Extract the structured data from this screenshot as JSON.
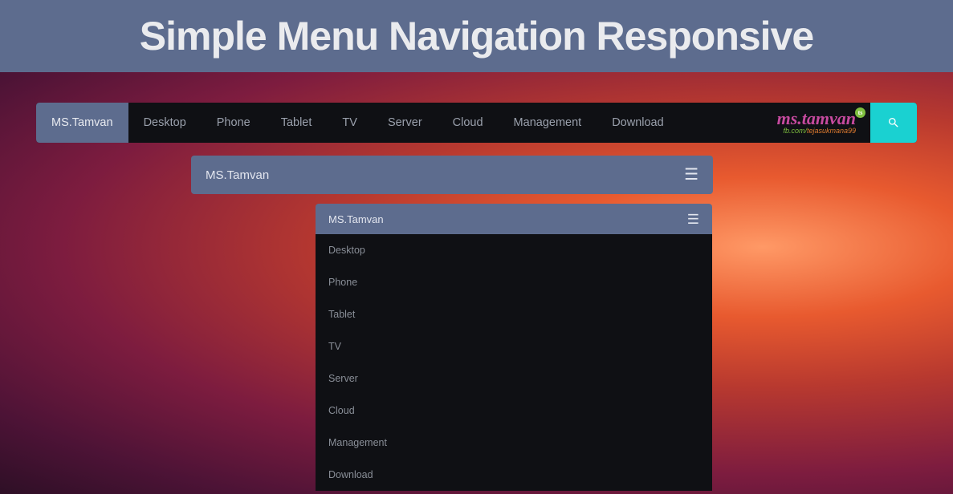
{
  "header": {
    "title": "Simple Menu Navigation Responsive"
  },
  "nav": {
    "brand": "MS.Tamvan",
    "items": [
      "Desktop",
      "Phone",
      "Tablet",
      "TV",
      "Server",
      "Cloud",
      "Management",
      "Download"
    ]
  },
  "logo": {
    "main": "ms.tamvan",
    "badge": "ts",
    "sub_prefix": "fb.com/",
    "sub_name": "tejasukmana99"
  },
  "collapsed": {
    "label": "MS.Tamvan"
  },
  "expanded": {
    "label": "MS.Tamvan",
    "items": [
      "Desktop",
      "Phone",
      "Tablet",
      "TV",
      "Server",
      "Cloud",
      "Management",
      "Download"
    ]
  }
}
